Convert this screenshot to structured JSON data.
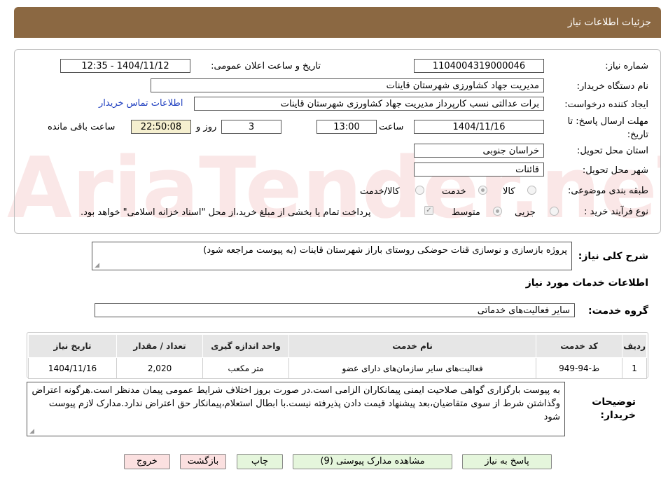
{
  "header": {
    "title": "جزئیات اطلاعات نیاز"
  },
  "watermark": {
    "text": "AriaTender.neT"
  },
  "fields": {
    "need_number": {
      "label": "شماره نیاز:",
      "value": "1104004319000046"
    },
    "announce_datetime": {
      "label": "تاریخ و ساعت اعلان عمومی:",
      "value": "1404/11/12 - 12:35"
    },
    "buyer_org": {
      "label": "نام دستگاه خریدار:",
      "value": "مدیریت جهاد کشاورزی شهرستان قاینات"
    },
    "requester": {
      "label": "ایجاد کننده درخواست:",
      "value": "برات عدالتی نسب کارپرداز مدیریت جهاد کشاورزی شهرستان قاینات"
    },
    "contact_link": "اطلاعات تماس خریدار",
    "deadline": {
      "label_line1": "مهلت ارسال پاسخ: تا",
      "label_line2": "تاریخ:",
      "date": "1404/11/16",
      "time_label": "ساعت",
      "time": "13:00",
      "days": "3",
      "days_label": "روز و",
      "remaining": "22:50:08",
      "remaining_label": "ساعت باقی مانده"
    },
    "province": {
      "label": "استان محل تحویل:",
      "value": "خراسان جنوبی"
    },
    "city": {
      "label": "شهر محل تحویل:",
      "value": "قائنات"
    },
    "category": {
      "label": "طبقه بندی موضوعی:",
      "options": [
        "کالا",
        "خدمت",
        "کالا/خدمت"
      ],
      "selected": "خدمت"
    },
    "purchase_type": {
      "label": "نوع فرآیند خرید :",
      "options": [
        "جزیی",
        "متوسط"
      ],
      "selected": "متوسط",
      "treasury_note": "پرداخت تمام یا بخشی از مبلغ خرید،از محل \"اسناد خزانه اسلامی\" خواهد بود.",
      "treasury_checked": true
    }
  },
  "description": {
    "label": "شرح کلی نیاز:",
    "value": "پروژه بازسازی و نوسازی قنات حوضکی روستای باراز شهرستان قاینات (به پیوست مراجعه شود)"
  },
  "services_section": {
    "title": "اطلاعات خدمات مورد نیاز",
    "group_label": "گروه خدمت:",
    "group_value": "سایر فعالیت‌های خدماتی"
  },
  "table": {
    "headers": [
      "ردیف",
      "کد خدمت",
      "نام خدمت",
      "واحد اندازه گیری",
      "تعداد / مقدار",
      "تاریخ نیاز"
    ],
    "rows": [
      [
        "1",
        "ط-94-949",
        "فعالیت‌های سایر سازمان‌های دارای عضو",
        "متر مکعب",
        "2,020",
        "1404/11/16"
      ]
    ]
  },
  "buyer_notes": {
    "label_line1": "توضیحات",
    "label_line2": "خریدار:",
    "value": "به پیوست بارگزاری گواهی صلاحیت ایمنی پیمانکاران الزامی است.در صورت بروز اختلاف شرایط عمومی پیمان مدنظر است.هرگونه اعتراض وگذاشتن شرط از سوی متقاضیان،بعد پیشنهاد قیمت دادن پذیرفته نیست.با ابطال استعلام،پیمانکار حق اعتراض ندارد.مدارک لازم پیوست شود"
  },
  "buttons": {
    "reply": "پاسخ به نیاز",
    "attachments": "مشاهده مدارک پیوستی (9)",
    "print": "چاپ",
    "back": "بازگشت",
    "exit": "خروج"
  },
  "colors": {
    "header_bg": "#8b6842",
    "link": "#1f3fc0",
    "green_button": "#e5f6dc",
    "pink_button": "#fbe0e0"
  }
}
